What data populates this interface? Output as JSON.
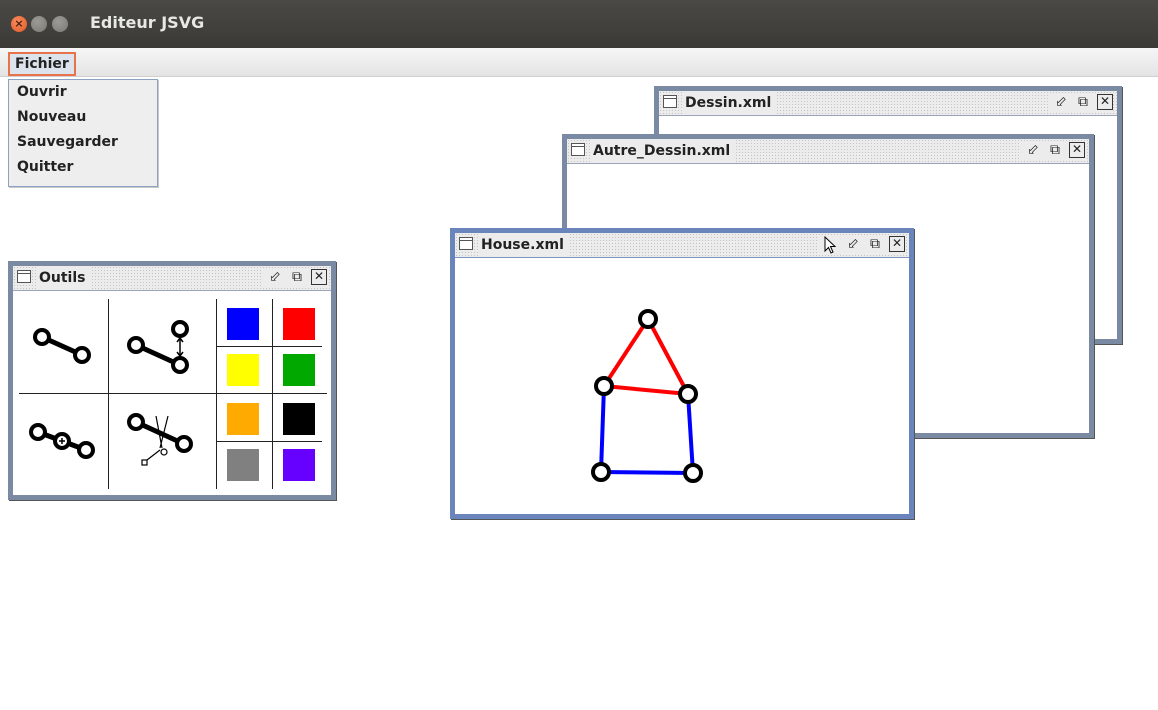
{
  "window": {
    "title": "Editeur JSVG"
  },
  "menu": {
    "fichier_label": "Fichier",
    "items": [
      "Ouvrir",
      "Nouveau",
      "Sauvegarder",
      "Quitter"
    ]
  },
  "frames": {
    "dessin": {
      "title": "Dessin.xml"
    },
    "autre": {
      "title": "Autre_Dessin.xml"
    },
    "house": {
      "title": "House.xml"
    },
    "outils": {
      "title": "Outils"
    }
  },
  "frame_controls": {
    "iconify_glyph": "⬃",
    "maximize_glyph": "⧉",
    "close_glyph": "✕"
  },
  "palette": {
    "colors": [
      "#0000ff",
      "#ff0000",
      "#ffff00",
      "#00a800",
      "#ffaa00",
      "#000000",
      "#808080",
      "#6600ff"
    ]
  },
  "tools": [
    "add-line-tool",
    "move-point-tool",
    "add-point-tool",
    "cut-line-tool"
  ],
  "house_drawing": {
    "edge_colors": {
      "roof": "#ff0000",
      "walls": "#0000ff"
    }
  }
}
